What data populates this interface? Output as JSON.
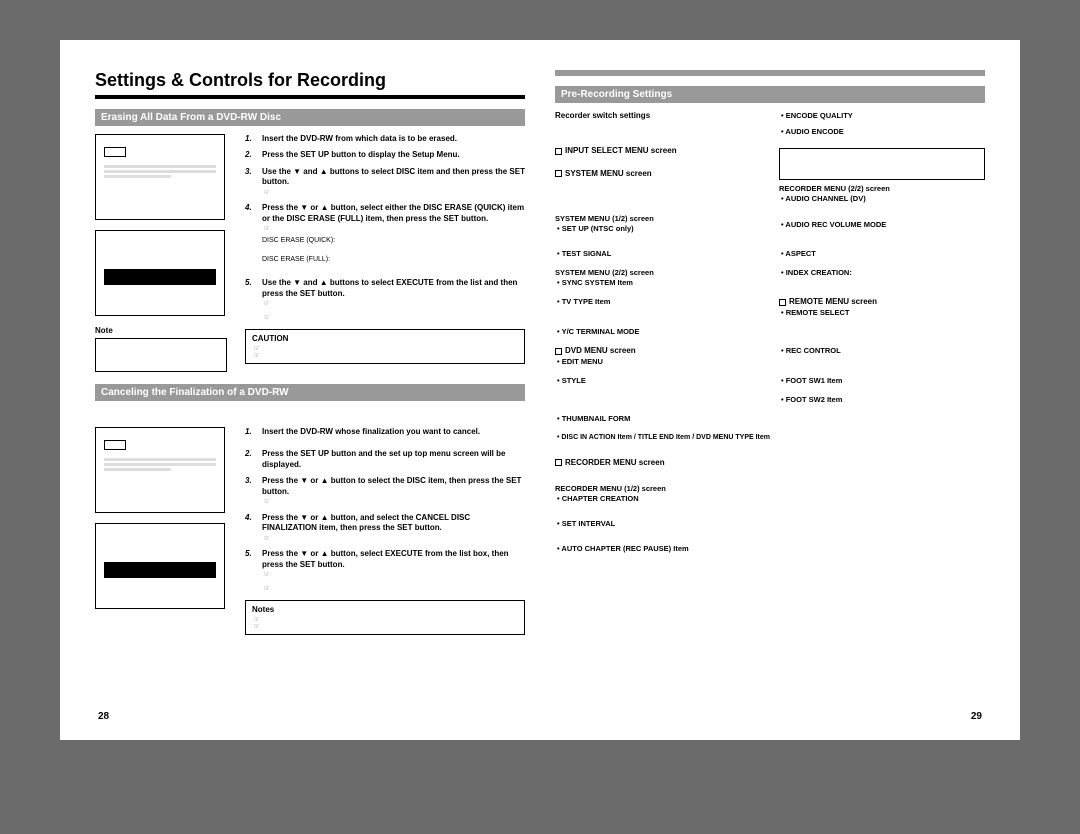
{
  "main_title": "Settings & Controls for Recording",
  "page_left": "28",
  "page_right": "29",
  "sec1": {
    "header": "Erasing All Data From a DVD-RW Disc",
    "s1": "Insert the DVD-RW from which data is to be erased.",
    "s2": "Press the SET UP button to display the Setup Menu.",
    "s3": "Use the ▼ and ▲ buttons to select DISC item and then press the SET button.",
    "s4": "Press the ▼ or ▲ button, select either the DISC ERASE (QUICK) item or the DISC ERASE (FULL) item, then press the SET button.",
    "s4a": "DISC ERASE (QUICK):",
    "s4b": "DISC ERASE (FULL):",
    "s5": "Use the ▼ and ▲ buttons to select EXECUTE from the list and then press the SET button.",
    "caution": "CAUTION",
    "note": "Note"
  },
  "sec2": {
    "header": "Canceling the Finalization of a DVD-RW",
    "s1": "Insert the DVD-RW whose finalization you want to cancel.",
    "s2": "Press the SET UP button and the set up top menu screen will be displayed.",
    "s3": "Press the ▼ or ▲ button to select the DISC item, then press the SET button.",
    "s4": "Press the ▼ or ▲ button, and select the CANCEL DISC FINALIZATION item, then press the SET button.",
    "s5": "Press the ▼ or ▲ button, select EXECUTE from the list box, then press the SET button.",
    "notes": "Notes"
  },
  "pre": {
    "header": "Pre-Recording Settings",
    "l1": "Recorder switch settings",
    "r1": "• ENCODE QUALITY",
    "r2": "• AUDIO ENCODE",
    "l2": "INPUT SELECT MENU screen",
    "l3": "SYSTEM MENU screen",
    "r3": "RECORDER MENU (2/2) screen",
    "r3b": "• AUDIO CHANNEL (DV)",
    "l4": "SYSTEM MENU (1/2) screen",
    "l4b": "• SET UP (NTSC only)",
    "r4": "• AUDIO REC VOLUME MODE",
    "l5": "• TEST SIGNAL",
    "r5": "• ASPECT",
    "l6": "SYSTEM MENU (2/2) screen",
    "l6b": "• SYNC SYSTEM Item",
    "r6": "• INDEX CREATION:",
    "l7": "• TV TYPE Item",
    "r7": "REMOTE MENU screen",
    "r7b": "• REMOTE SELECT",
    "l8": "• Y/C TERMINAL MODE",
    "l9": "DVD MENU screen",
    "l9b": "• EDIT MENU",
    "r8": "• REC CONTROL",
    "l10": "• STYLE",
    "r9": "• FOOT SW1 Item",
    "r10": "• FOOT SW2 Item",
    "l11": "• THUMBNAIL FORM",
    "l12": "• DISC IN ACTION Item / TITLE END Item / DVD MENU TYPE Item",
    "l13": "RECORDER MENU screen",
    "l14": "RECORDER MENU (1/2) screen",
    "l14b": "• CHAPTER CREATION",
    "l15": "• SET INTERVAL",
    "l16": "• AUTO CHAPTER (REC PAUSE) Item"
  }
}
